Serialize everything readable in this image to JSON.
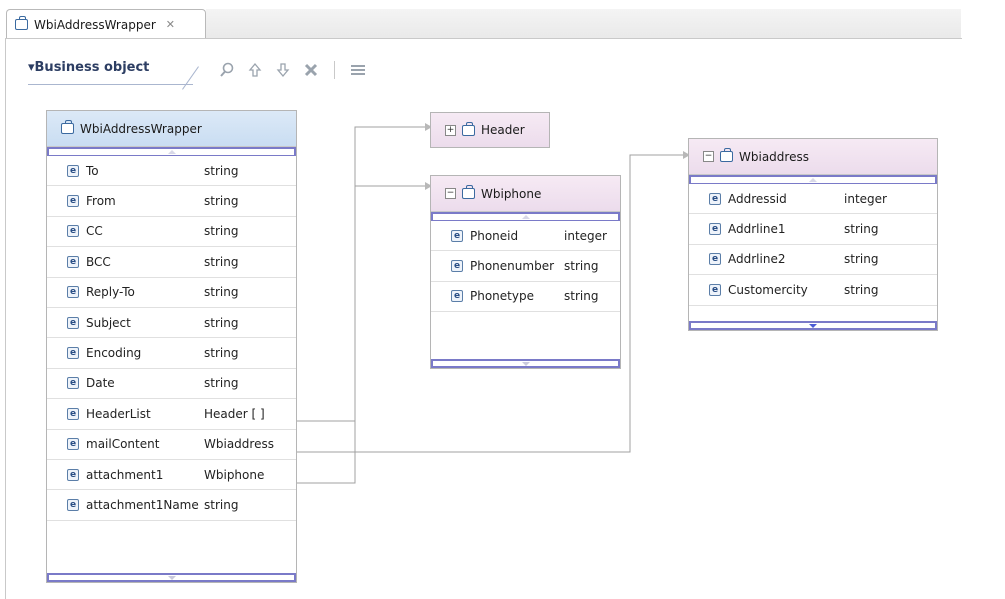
{
  "tab": {
    "title": "WbiAddressWrapper",
    "close": "✕"
  },
  "section": {
    "title": "▾Business object"
  },
  "toolbar": {
    "icons": [
      "search-icon",
      "move-up-icon",
      "move-down-icon",
      "delete-icon",
      "properties-icon"
    ]
  },
  "main_bo": {
    "name": "WbiAddressWrapper",
    "fields": [
      {
        "name": "To",
        "type": "string"
      },
      {
        "name": "From",
        "type": "string"
      },
      {
        "name": "CC",
        "type": "string"
      },
      {
        "name": "BCC",
        "type": "string"
      },
      {
        "name": "Reply-To",
        "type": "string"
      },
      {
        "name": "Subject",
        "type": "string"
      },
      {
        "name": "Encoding",
        "type": "string"
      },
      {
        "name": "Date",
        "type": "string"
      },
      {
        "name": "HeaderList",
        "type": "Header [ ]"
      },
      {
        "name": "mailContent",
        "type": "Wbiaddress"
      },
      {
        "name": "attachment1",
        "type": "Wbiphone"
      },
      {
        "name": "attachment1Name",
        "type": "string"
      }
    ]
  },
  "header_bo": {
    "name": "Header",
    "expander": "+"
  },
  "phone_bo": {
    "name": "Wbiphone",
    "expander": "−",
    "fields": [
      {
        "name": "Phoneid",
        "type": "integer"
      },
      {
        "name": "Phonenumber",
        "type": "string"
      },
      {
        "name": "Phonetype",
        "type": "string"
      }
    ]
  },
  "address_bo": {
    "name": "Wbiaddress",
    "expander": "−",
    "fields": [
      {
        "name": "Addressid",
        "type": "integer"
      },
      {
        "name": "Addrline1",
        "type": "string"
      },
      {
        "name": "Addrline2",
        "type": "string"
      },
      {
        "name": "Customercity",
        "type": "string"
      }
    ]
  },
  "field_icon_letter": "e",
  "colors": {
    "blue_header": "#c9ddf2",
    "pink_header": "#ecdcec",
    "scroll_border": "#7a7ac8",
    "connector": "#a0a0a0"
  }
}
